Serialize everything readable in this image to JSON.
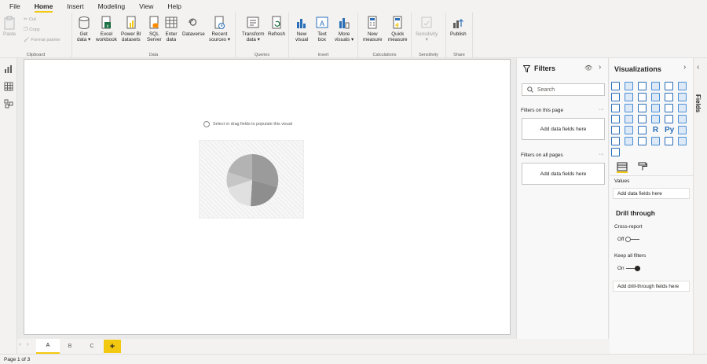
{
  "menu": [
    "File",
    "Home",
    "Insert",
    "Modeling",
    "View",
    "Help"
  ],
  "menu_active": "Home",
  "ribbon": {
    "clipboard": {
      "paste": "Paste",
      "cut": "Cut",
      "copy": "Copy",
      "format_painter": "Format painter",
      "label": "Clipboard"
    },
    "data": {
      "label": "Data",
      "get_data": [
        "Get",
        "data ▾"
      ],
      "excel": [
        "Excel",
        "workbook"
      ],
      "powerbi": [
        "Power BI",
        "datasets"
      ],
      "sql": [
        "SQL",
        "Server"
      ],
      "enter": [
        "Enter",
        "data"
      ],
      "dataverse": [
        "Dataverse",
        ""
      ],
      "recent": [
        "Recent",
        "sources ▾"
      ]
    },
    "queries": {
      "label": "Queries",
      "transform": [
        "Transform",
        "data ▾"
      ],
      "refresh": [
        "Refresh",
        ""
      ]
    },
    "insert": {
      "label": "Insert",
      "new_visual": [
        "New",
        "visual"
      ],
      "text_box": [
        "Text",
        "box"
      ],
      "more_visuals": [
        "More",
        "visuals ▾"
      ]
    },
    "calculations": {
      "label": "Calculations",
      "new_measure": [
        "New",
        "measure"
      ],
      "quick_measure": [
        "Quick",
        "measure"
      ]
    },
    "sensitivity": {
      "label": "Sensitivity",
      "btn": [
        "Sensitivity",
        "▾"
      ]
    },
    "share": {
      "label": "Share",
      "publish": [
        "Publish",
        ""
      ]
    }
  },
  "canvas": {
    "hint": "Select or drag fields to populate this visual",
    "pie_colors": [
      "#9b9b9b",
      "#c6c6c6",
      "#e0e0e0",
      "#b3b3b3",
      "#8e8e8e"
    ]
  },
  "filters": {
    "title": "Filters",
    "search_placeholder": "Search",
    "on_page": "Filters on this page",
    "on_all": "Filters on all pages",
    "add_fields": "Add data fields here"
  },
  "visualizations": {
    "title": "Visualizations",
    "values_label": "Values",
    "add_fields": "Add data fields here",
    "drill_title": "Drill through",
    "cross_report": "Cross-report",
    "cross_state": "Off",
    "keep_filters": "Keep all filters",
    "keep_state": "On",
    "add_drill": "Add drill-through fields here",
    "icon_r": "R",
    "icon_py": "Py"
  },
  "fields_label": "Fields",
  "pages": [
    "A",
    "B",
    "C"
  ],
  "active_page": "A",
  "add_page": "+",
  "status": "Page 1 of 3",
  "colors": {
    "accent": "#f2c811",
    "viz_blue": "#2b6fb8"
  }
}
